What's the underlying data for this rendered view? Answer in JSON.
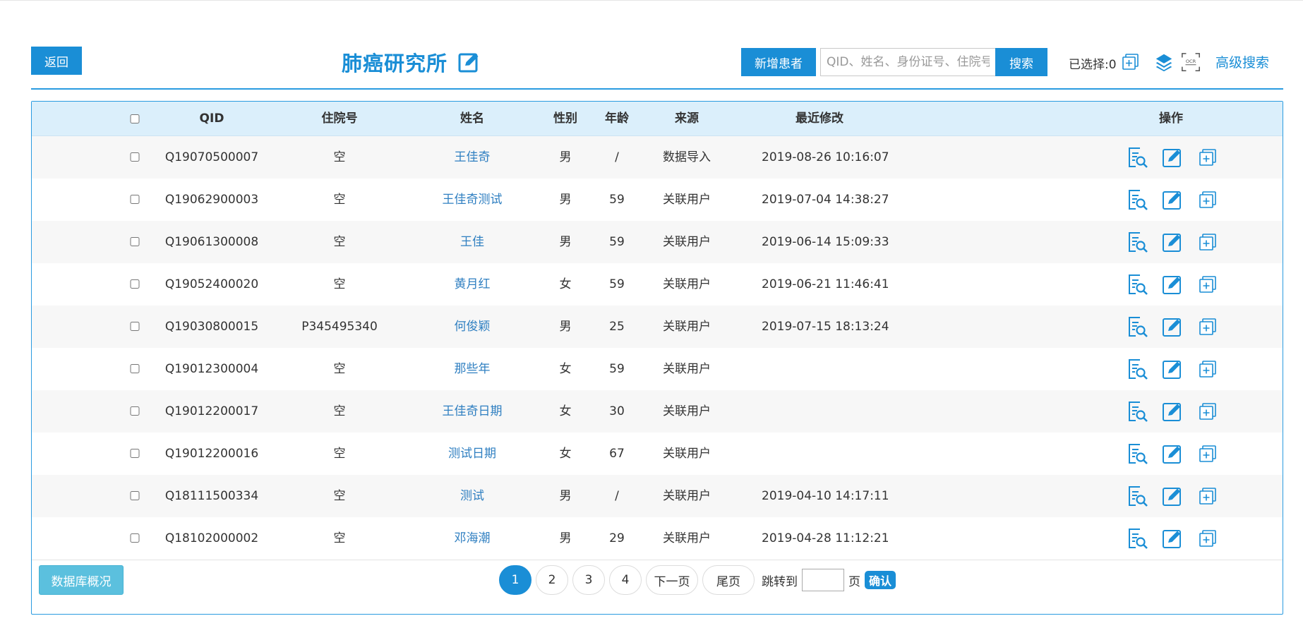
{
  "header": {
    "back_label": "返回",
    "title": "肺癌研究所",
    "add_patient_label": "新增患者",
    "search_placeholder": "QID、姓名、身份证号、住院号",
    "search_label": "搜索",
    "selected_label": "已选择:0",
    "advanced_search_label": "高级搜索"
  },
  "table": {
    "columns": {
      "qid": "QID",
      "admission": "住院号",
      "name": "姓名",
      "gender": "性别",
      "age": "年龄",
      "source": "来源",
      "modified": "最近修改",
      "actions": "操作"
    },
    "rows": [
      {
        "qid": "Q19070500007",
        "admission": "空",
        "name": "王佳奇",
        "gender": "男",
        "age": "/",
        "source": "数据导入",
        "modified": "2019-08-26 10:16:07"
      },
      {
        "qid": "Q19062900003",
        "admission": "空",
        "name": "王佳奇测试",
        "gender": "男",
        "age": "59",
        "source": "关联用户",
        "modified": "2019-07-04 14:38:27"
      },
      {
        "qid": "Q19061300008",
        "admission": "空",
        "name": "王佳",
        "gender": "男",
        "age": "59",
        "source": "关联用户",
        "modified": "2019-06-14 15:09:33"
      },
      {
        "qid": "Q19052400020",
        "admission": "空",
        "name": "黄月红",
        "gender": "女",
        "age": "59",
        "source": "关联用户",
        "modified": "2019-06-21 11:46:41"
      },
      {
        "qid": "Q19030800015",
        "admission": "P345495340",
        "name": "何俊颖",
        "gender": "男",
        "age": "25",
        "source": "关联用户",
        "modified": "2019-07-15 18:13:24"
      },
      {
        "qid": "Q19012300004",
        "admission": "空",
        "name": "那些年",
        "gender": "女",
        "age": "59",
        "source": "关联用户",
        "modified": ""
      },
      {
        "qid": "Q19012200017",
        "admission": "空",
        "name": "王佳奇日期",
        "gender": "女",
        "age": "30",
        "source": "关联用户",
        "modified": ""
      },
      {
        "qid": "Q19012200016",
        "admission": "空",
        "name": "测试日期",
        "gender": "女",
        "age": "67",
        "source": "关联用户",
        "modified": ""
      },
      {
        "qid": "Q18111500334",
        "admission": "空",
        "name": "测试",
        "gender": "男",
        "age": "/",
        "source": "关联用户",
        "modified": "2019-04-10 14:17:11"
      },
      {
        "qid": "Q18102000002",
        "admission": "空",
        "name": "邓海潮",
        "gender": "男",
        "age": "29",
        "source": "关联用户",
        "modified": "2019-04-28 11:12:21"
      }
    ]
  },
  "footer": {
    "overview_label": "数据库概况",
    "pages": [
      "1",
      "2",
      "3",
      "4"
    ],
    "current_page": "1",
    "next_label": "下一页",
    "last_label": "尾页",
    "jump_to_label": "跳转到",
    "page_suffix": "页",
    "confirm_label": "确认"
  },
  "icons": {
    "edit_title": "edit-icon",
    "add_selected": "add-copy-icon",
    "layers": "layers-icon",
    "ocr": "ocr-scan-icon",
    "row_view": "view-record-icon",
    "row_edit": "edit-icon",
    "row_add": "add-copy-icon"
  },
  "colors": {
    "primary": "#1a8ed6",
    "header_bg": "#dbeffb",
    "link": "#2f7fc1",
    "overview_button": "#5bc0de"
  }
}
